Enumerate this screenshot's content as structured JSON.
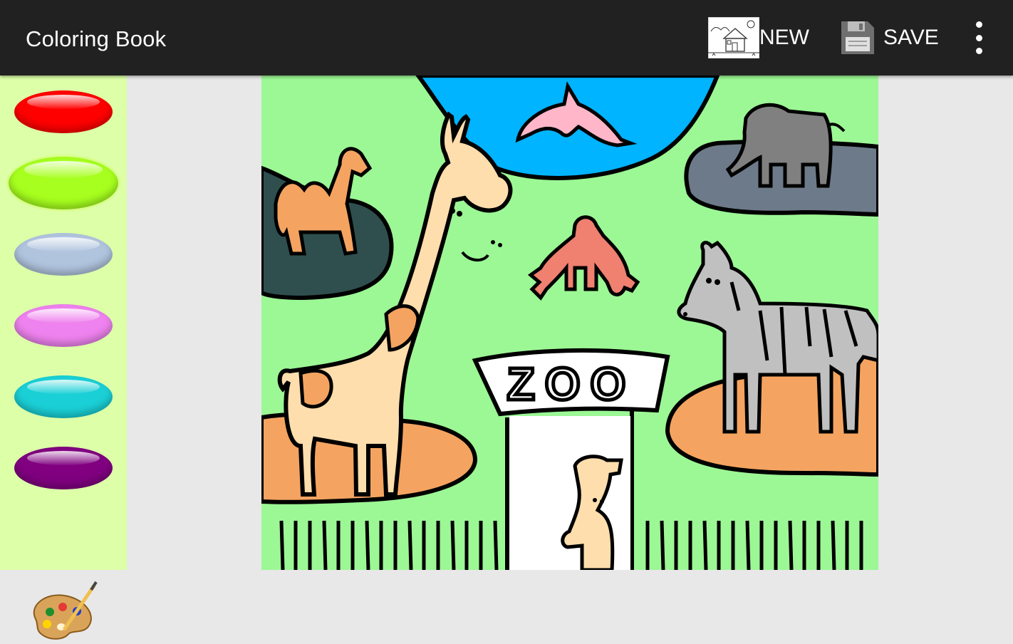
{
  "app": {
    "title": "Coloring Book"
  },
  "toolbar": {
    "new_label": "NEW",
    "save_label": "SAVE",
    "new_icon": "house-thumbnail-icon",
    "save_icon": "floppy-disk-icon",
    "overflow_icon": "more-vert-icon"
  },
  "palette": {
    "colors": [
      {
        "name": "red",
        "hex": "#ff0000"
      },
      {
        "name": "lime",
        "hex": "#a6ff1e"
      },
      {
        "name": "light-steel-blue",
        "hex": "#b0c4de"
      },
      {
        "name": "violet",
        "hex": "#ee82ee"
      },
      {
        "name": "cyan",
        "hex": "#1ad0d6"
      },
      {
        "name": "purple",
        "hex": "#800080"
      }
    ],
    "selected_index": 1,
    "more_colors_icon": "artist-palette-icon"
  },
  "canvas": {
    "sign_text": "ZOO",
    "colors": {
      "grass": "#9cf795",
      "water": "#00b4ff",
      "dolphin": "#ffb6c8",
      "elephant": "#808080",
      "elephant_pool": "#6d7a89",
      "camel": "#f4a460",
      "camel_pool": "#2f4f4f",
      "giraffe": "#ffdead",
      "monkey": "#f08070",
      "zebra": "#c0c0c0",
      "ground": "#f4a460",
      "sign": "#ffffff"
    }
  }
}
